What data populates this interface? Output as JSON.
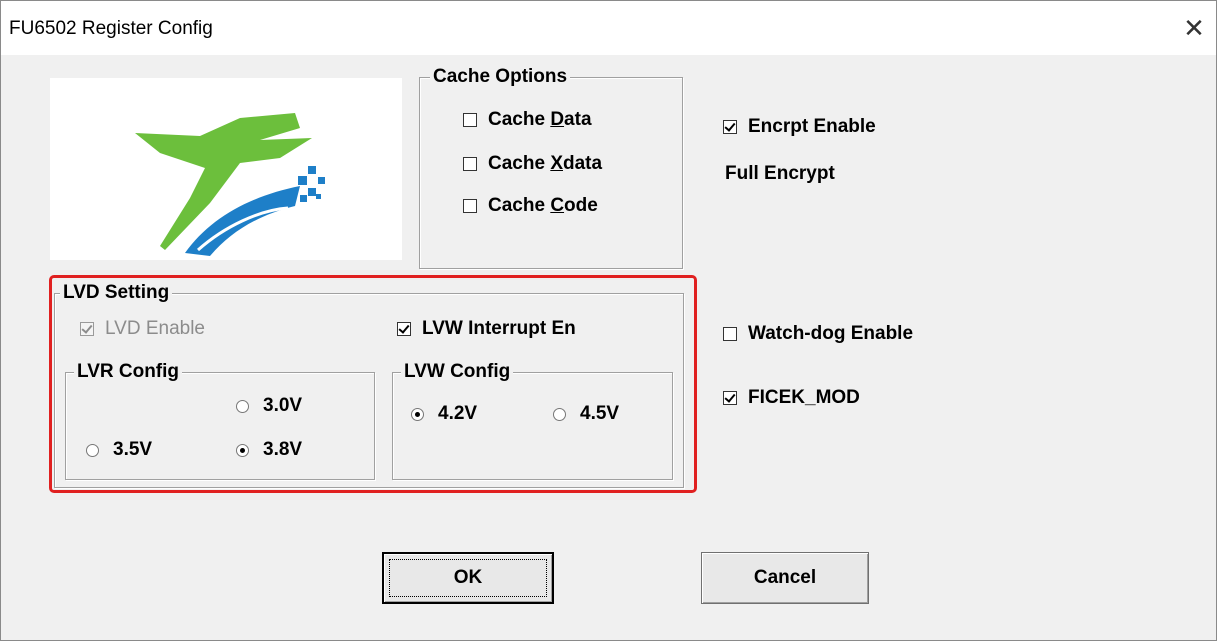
{
  "window": {
    "title": "FU6502 Register Config",
    "close_icon": "close-icon"
  },
  "cache_options": {
    "label": "Cache Options",
    "items": [
      {
        "pre": "Cache ",
        "key": "D",
        "post": "ata",
        "checked": false
      },
      {
        "pre": "Cache ",
        "key": "X",
        "post": "data",
        "checked": false
      },
      {
        "pre": "Cache ",
        "key": "C",
        "post": "ode",
        "checked": false
      }
    ]
  },
  "encrypt": {
    "label": "Encrpt Enable",
    "checked": true,
    "mode_text": "Full Encrypt"
  },
  "lvd": {
    "label": "LVD Setting",
    "lvd_enable": {
      "label": "LVD Enable",
      "checked": true,
      "disabled": true
    },
    "lvw_interrupt": {
      "label": "LVW Interrupt En",
      "checked": true
    },
    "lvr_config": {
      "label": "LVR Config",
      "options": [
        {
          "label": "3.0V",
          "selected": false
        },
        {
          "label": "3.5V",
          "selected": false
        },
        {
          "label": "3.8V",
          "selected": true
        }
      ]
    },
    "lvw_config": {
      "label": "LVW Config",
      "options": [
        {
          "label": "4.2V",
          "selected": true
        },
        {
          "label": "4.5V",
          "selected": false
        }
      ]
    }
  },
  "watchdog": {
    "label": "Watch-dog Enable",
    "checked": false
  },
  "ficek_mod": {
    "label": "FICEK_MOD",
    "checked": true
  },
  "buttons": {
    "ok": "OK",
    "cancel": "Cancel"
  },
  "colors": {
    "highlight_frame": "#e02020",
    "logo_green": "#6cbf3c",
    "logo_blue": "#1e7fc8"
  }
}
